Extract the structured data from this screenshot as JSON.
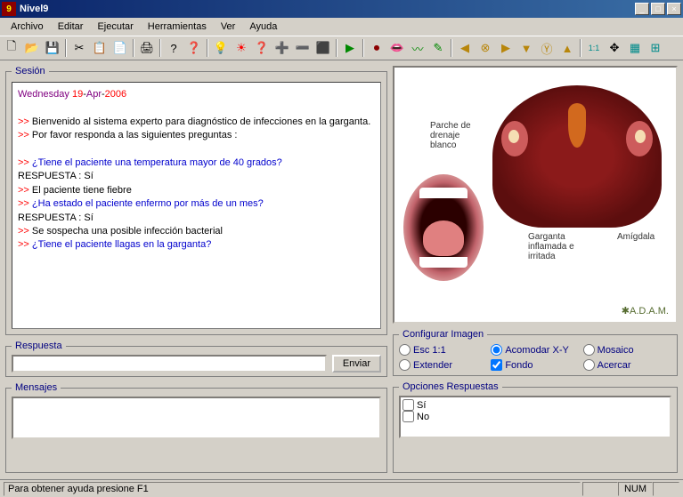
{
  "window": {
    "title": "Nivel9"
  },
  "menu": [
    "Archivo",
    "Editar",
    "Ejecutar",
    "Herramientas",
    "Ver",
    "Ayuda"
  ],
  "panels": {
    "session": "Sesión",
    "respuesta": "Respuesta",
    "mensajes": "Mensajes",
    "config_img": "Configurar Imagen",
    "opciones": "Opciones Respuestas"
  },
  "session": {
    "date_day": "Wednesday",
    "date_d": "19",
    "date_m": "Apr",
    "date_y": "2006",
    "lines": [
      {
        "pfx": ">>",
        "txt": " Bienvenido al sistema experto para diagnóstico de infecciones en la garganta.",
        "cls": "sys"
      },
      {
        "pfx": ">>",
        "txt": " Por favor responda a las siguientes preguntas :",
        "cls": "sys"
      },
      {
        "pfx": "",
        "txt": "",
        "cls": "sys"
      },
      {
        "pfx": ">>",
        "txt": " ¿Tiene el paciente una temperatura mayor de 40 grados?",
        "cls": "q"
      },
      {
        "pfx": "",
        "txt": "RESPUESTA : Sí",
        "cls": "sys"
      },
      {
        "pfx": ">>",
        "txt": " El paciente tiene fiebre",
        "cls": "sys"
      },
      {
        "pfx": ">>",
        "txt": " ¿Ha estado el paciente enfermo por más de un mes?",
        "cls": "q"
      },
      {
        "pfx": "",
        "txt": "RESPUESTA : Sí",
        "cls": "sys"
      },
      {
        "pfx": ">>",
        "txt": " Se sospecha una posible infección bacterial",
        "cls": "sys"
      },
      {
        "pfx": ">>",
        "txt": " ¿Tiene el paciente  llagas en la garganta?",
        "cls": "q"
      }
    ]
  },
  "respuesta": {
    "value": "",
    "send": "Enviar"
  },
  "image_labels": {
    "parche": "Parche de drenaje blanco",
    "garganta": "Garganta inflamada e irritada",
    "amigdala": "Amígdala",
    "adam": "✱A.D.A.M."
  },
  "config_img": {
    "esc": "Esc 1:1",
    "acomodar": "Acomodar X-Y",
    "mosaico": "Mosaico",
    "extender": "Extender",
    "fondo": "Fondo",
    "acercar": "Acercar",
    "selected_radio": "acomodar",
    "fondo_checked": true
  },
  "opciones": {
    "si": "Sí",
    "no": "No"
  },
  "status": {
    "help": "Para obtener ayuda presione F1",
    "num": "NUM"
  }
}
